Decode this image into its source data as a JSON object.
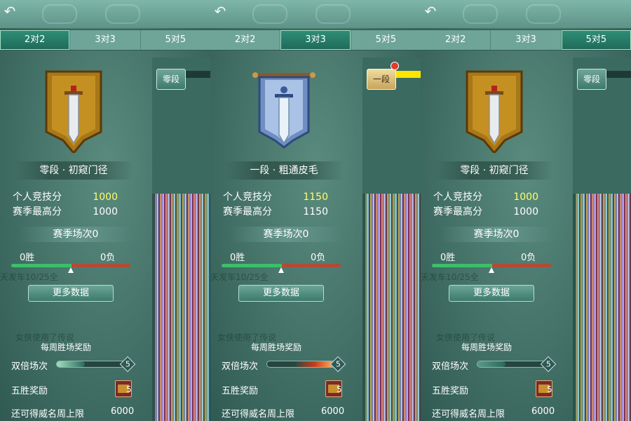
{
  "panels": [
    {
      "tabs": [
        "2对2",
        "3对3",
        "5对5"
      ],
      "active_tab": 0,
      "rank_title": "零段 · 初窥门径",
      "personal_score_label": "个人竞技分",
      "personal_score": "1000",
      "season_high_label": "赛季最高分",
      "season_high": "1000",
      "season_matches": "赛季场次0",
      "wins": "0胜",
      "losses": "0负",
      "more_data": "更多数据",
      "faded_news": "天发车10/25全",
      "faded_news2": "女侠使用了传说",
      "weekly_reward_title": "每周胜场奖励",
      "double_label": "双倍场次",
      "double_count": "5",
      "five_win_label": "五胜奖励",
      "chest_count": "5",
      "cap_label": "还可得威名周上限",
      "cap_value": "6000",
      "side_rank_tag": "零段"
    },
    {
      "tabs": [
        "2对2",
        "3对3",
        "5对5"
      ],
      "active_tab": 1,
      "rank_title": "一段 · 粗通皮毛",
      "personal_score_label": "个人竞技分",
      "personal_score": "1150",
      "season_high_label": "赛季最高分",
      "season_high": "1150",
      "season_matches": "赛季场次0",
      "wins": "0胜",
      "losses": "0负",
      "more_data": "更多数据",
      "faded_news": "天发车10/25全",
      "faded_news2": "女侠使用了传说",
      "weekly_reward_title": "每周胜场奖励",
      "double_label": "双倍场次",
      "double_count": "5",
      "five_win_label": "五胜奖励",
      "chest_count": "5",
      "cap_label": "还可得威名周上限",
      "cap_value": "6000",
      "side_rank_tag": "一段"
    },
    {
      "tabs": [
        "2对2",
        "3对3",
        "5对5"
      ],
      "active_tab": 2,
      "rank_title": "零段 · 初窥门径",
      "personal_score_label": "个人竞技分",
      "personal_score": "1000",
      "season_high_label": "赛季最高分",
      "season_high": "1000",
      "season_matches": "赛季场次0",
      "wins": "0胜",
      "losses": "0负",
      "more_data": "更多数据",
      "faded_news": "天发车10/25全",
      "faded_news2": "女侠使用了传说",
      "weekly_reward_title": "每周胜场奖励",
      "double_label": "双倍场次",
      "double_count": "5",
      "five_win_label": "五胜奖励",
      "chest_count": "5",
      "cap_label": "还可得威名周上限",
      "cap_value": "6000",
      "side_rank_tag": "零段"
    }
  ],
  "colors": {
    "score_highlight": "#ffff66",
    "win_bar": "#3cbf6b",
    "loss_bar": "#b34a36",
    "active_tab": "#2f8e78"
  },
  "icons": [
    "back-arrow-icon",
    "sword-banner-icon",
    "treasure-chest-icon",
    "notification-dot-icon"
  ]
}
